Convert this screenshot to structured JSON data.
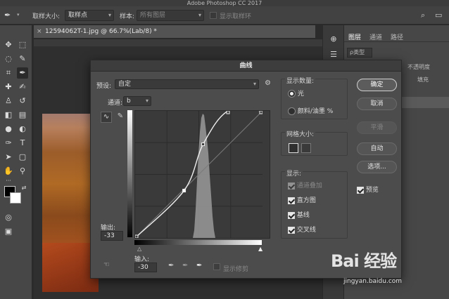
{
  "app": {
    "title": "Adobe Photoshop CC 2017"
  },
  "options_bar": {
    "sample_size_label": "取样大小:",
    "sample_size_value": "取样点",
    "sample_label": "样本:",
    "sample_value": "所有图层",
    "show_ring_label": "显示取样环"
  },
  "document": {
    "tab_title": "12594062T-1.jpg @ 66.7%(Lab/8) *"
  },
  "layers_panel": {
    "tabs": [
      "图层",
      "通道",
      "路径"
    ],
    "kind_label": "ρ类型",
    "opacity_label": "不透明度",
    "fill_label": "填充"
  },
  "curves": {
    "title": "曲线",
    "preset_label": "预设:",
    "preset_value": "自定",
    "channel_label": "通道:",
    "channel_value": "b",
    "output_label": "输出:",
    "output_value": "-33",
    "input_label": "输入:",
    "input_value": "-30",
    "show_clipping_label": "显示修剪",
    "show_amount": {
      "title": "显示数量:",
      "options": [
        {
          "label": "光",
          "selected": true
        },
        {
          "label": "颜料/油墨 %",
          "selected": false
        }
      ]
    },
    "grid_size": {
      "title": "网格大小:"
    },
    "display": {
      "title": "显示:",
      "items": [
        {
          "label": "通道叠加",
          "checked": true,
          "disabled": true
        },
        {
          "label": "直方图",
          "checked": true,
          "disabled": false
        },
        {
          "label": "基线",
          "checked": true,
          "disabled": false
        },
        {
          "label": "交叉线",
          "checked": true,
          "disabled": false
        }
      ]
    },
    "buttons": {
      "ok": "确定",
      "cancel": "取消",
      "smooth": "平滑",
      "auto": "自动",
      "options": "选项..."
    },
    "preview_label": "预览",
    "input_range": [
      -128,
      127
    ],
    "curve_points": [
      [
        -128,
        -128
      ],
      [
        -30,
        -33
      ],
      [
        8,
        60
      ],
      [
        58,
        127
      ],
      [
        127,
        127
      ]
    ]
  },
  "watermark": {
    "brand": "Bai 经验",
    "url": "jingyan.baidu.com"
  },
  "colors": {
    "accent": "#ffffff",
    "panel_bg": "#4c4c4c",
    "dark_bg": "#2b2b2b"
  }
}
